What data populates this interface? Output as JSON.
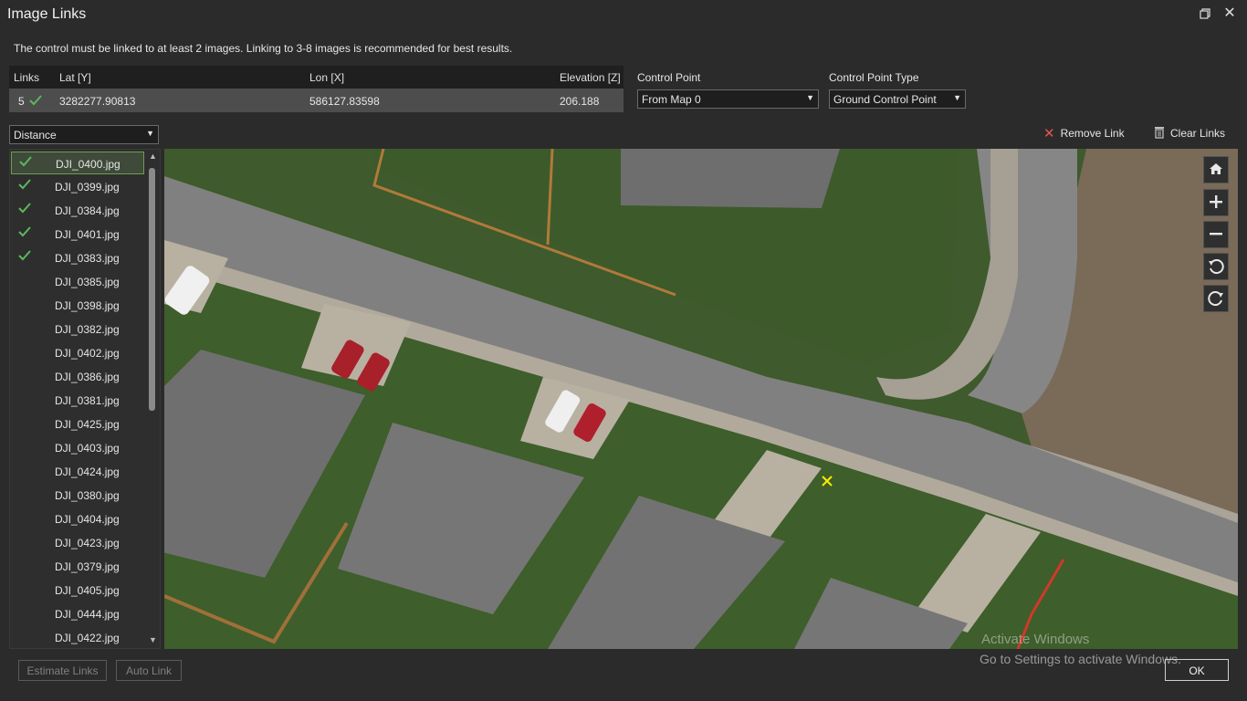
{
  "window": {
    "title": "Image Links"
  },
  "info_text": "The control must be linked to at least 2 images. Linking to 3-8 images is recommended for best results.",
  "links_table": {
    "headers": {
      "links": "Links",
      "lat": "Lat [Y]",
      "lon": "Lon [X]",
      "elevation": "Elevation [Z]"
    },
    "row": {
      "links": "5",
      "lat": "3282277.90813",
      "lon": "586127.83598",
      "elevation": "206.188"
    }
  },
  "control_point": {
    "label": "Control Point",
    "value": "From Map 0"
  },
  "control_point_type": {
    "label": "Control Point Type",
    "value": "Ground Control Point"
  },
  "sort": {
    "value": "Distance"
  },
  "actions": {
    "remove_link": "Remove Link",
    "clear_links": "Clear Links"
  },
  "images": [
    {
      "name": "DJI_0400.jpg",
      "linked": true,
      "selected": true
    },
    {
      "name": "DJI_0399.jpg",
      "linked": true,
      "selected": false
    },
    {
      "name": "DJI_0384.jpg",
      "linked": true,
      "selected": false
    },
    {
      "name": "DJI_0401.jpg",
      "linked": true,
      "selected": false
    },
    {
      "name": "DJI_0383.jpg",
      "linked": true,
      "selected": false
    },
    {
      "name": "DJI_0385.jpg",
      "linked": false,
      "selected": false
    },
    {
      "name": "DJI_0398.jpg",
      "linked": false,
      "selected": false
    },
    {
      "name": "DJI_0382.jpg",
      "linked": false,
      "selected": false
    },
    {
      "name": "DJI_0402.jpg",
      "linked": false,
      "selected": false
    },
    {
      "name": "DJI_0386.jpg",
      "linked": false,
      "selected": false
    },
    {
      "name": "DJI_0381.jpg",
      "linked": false,
      "selected": false
    },
    {
      "name": "DJI_0425.jpg",
      "linked": false,
      "selected": false
    },
    {
      "name": "DJI_0403.jpg",
      "linked": false,
      "selected": false
    },
    {
      "name": "DJI_0424.jpg",
      "linked": false,
      "selected": false
    },
    {
      "name": "DJI_0380.jpg",
      "linked": false,
      "selected": false
    },
    {
      "name": "DJI_0404.jpg",
      "linked": false,
      "selected": false
    },
    {
      "name": "DJI_0423.jpg",
      "linked": false,
      "selected": false
    },
    {
      "name": "DJI_0379.jpg",
      "linked": false,
      "selected": false
    },
    {
      "name": "DJI_0405.jpg",
      "linked": false,
      "selected": false
    },
    {
      "name": "DJI_0444.jpg",
      "linked": false,
      "selected": false
    },
    {
      "name": "DJI_0422.jpg",
      "linked": false,
      "selected": false
    }
  ],
  "map_controls": [
    "home-icon",
    "zoom-in-icon",
    "zoom-out-icon",
    "rotate-left-icon",
    "rotate-right-icon"
  ],
  "buttons": {
    "estimate_links": "Estimate Links",
    "auto_link": "Auto Link",
    "ok": "OK"
  },
  "watermark": {
    "line1": "Activate Windows",
    "line2": "Go to Settings to activate Windows."
  },
  "colors": {
    "check": "#5cb85c",
    "marker": "#ffeb00",
    "remove": "#e2574c"
  }
}
